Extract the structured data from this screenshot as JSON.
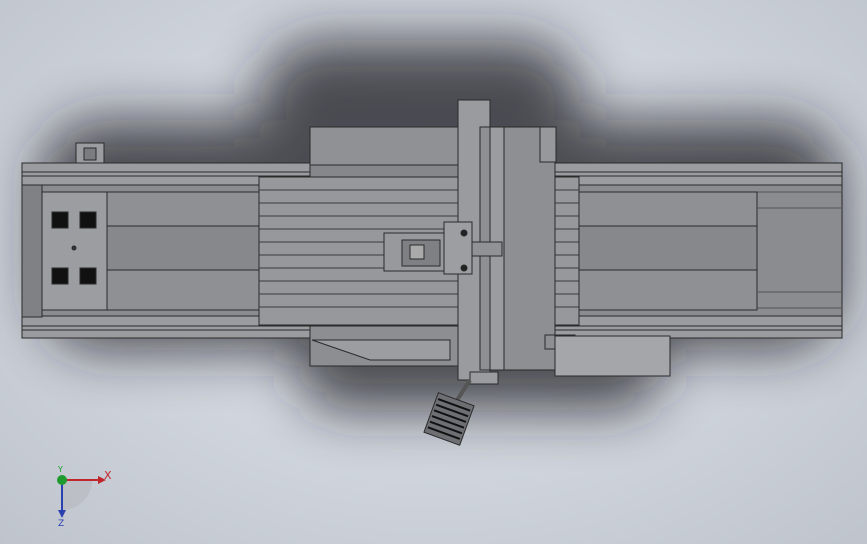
{
  "view": {
    "background_top": "#dfe3ea",
    "background_bottom": "#bfc4cc",
    "body_color": "#8a8c8f",
    "line_color": "#2a2a2a"
  },
  "triad": {
    "x_label": "X",
    "y_label": "Y",
    "z_label": "Z",
    "x_color": "#c0262b",
    "y_color": "#1f9a2e",
    "z_color": "#2a3fb0"
  }
}
